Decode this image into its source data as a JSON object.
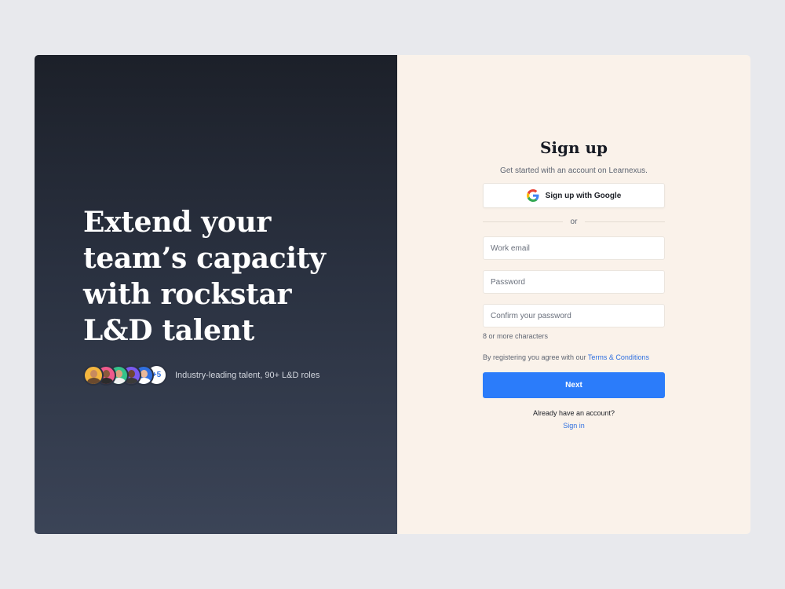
{
  "hero": {
    "headline": "Extend your team’s capacity with rockstar L&D talent",
    "avatars": [
      {
        "bg": "#f4b63f",
        "skin": "#c98a5e",
        "shirt": "#6b4a2e"
      },
      {
        "bg": "#f05a8c",
        "skin": "#8a5a3c",
        "shirt": "#2b2b2b"
      },
      {
        "bg": "#35c28a",
        "skin": "#d9a27c",
        "shirt": "#f1f1f1"
      },
      {
        "bg": "#7a5af0",
        "skin": "#6e4630",
        "shirt": "#3a3a3a"
      },
      {
        "bg": "#2f6fe0",
        "skin": "#e8b89a",
        "shirt": "#ffffff"
      }
    ],
    "more_count": "+5",
    "proof_text": "Industry-leading talent, 90+ L&D roles"
  },
  "form": {
    "title": "Sign up",
    "subtitle": "Get started with an account on Learnexus.",
    "google_label": "Sign up with Google",
    "divider_text": "or",
    "email_placeholder": "Work email",
    "password_placeholder": "Password",
    "confirm_placeholder": "Confirm your password",
    "password_hint": "8 or more characters",
    "terms_prefix": "By registering you agree with our",
    "terms_link": "Terms & Conditions",
    "next_label": "Next",
    "have_account": "Already have an account?",
    "signin_link": "Sign in"
  },
  "colors": {
    "accent": "#2b7cfa",
    "link": "#2f6fe0",
    "panel_bg": "#faf2ea",
    "hero_dark": "#1c2029"
  }
}
